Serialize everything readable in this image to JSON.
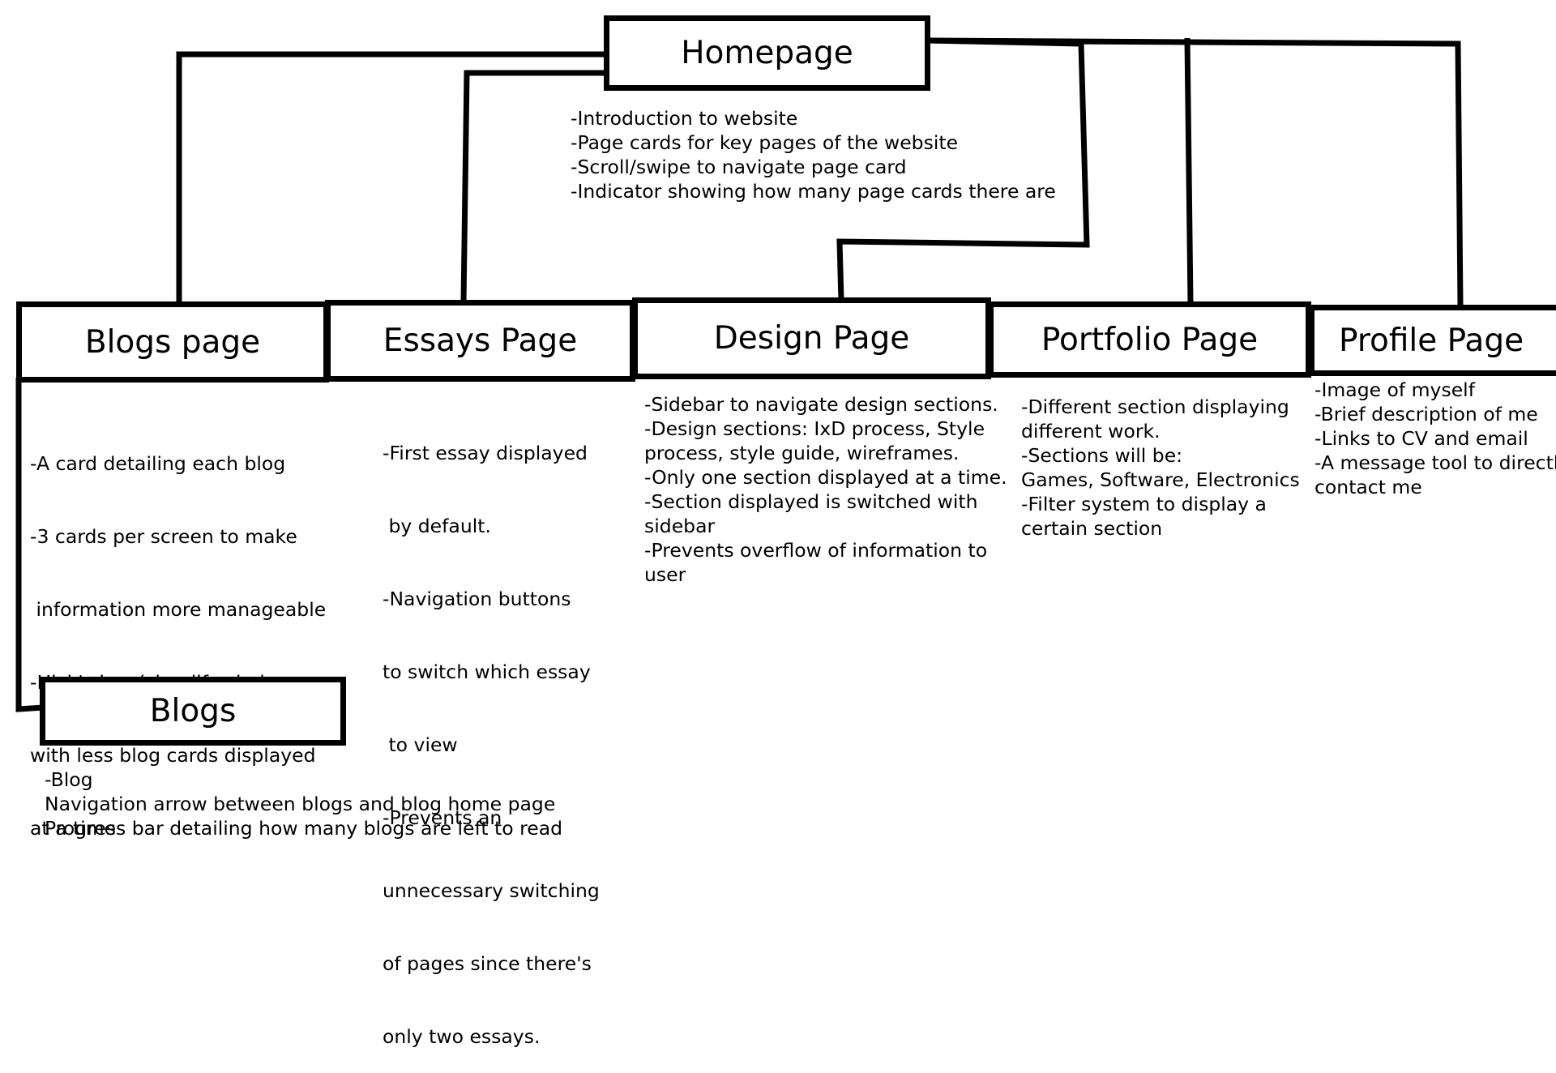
{
  "nodes": {
    "homepage": {
      "label": "Homepage",
      "notes": [
        "-Introduction to website",
        "-Page cards for key pages of the website",
        "-Scroll/swipe to navigate page card",
        "-Indicator showing how many page cards there are"
      ]
    },
    "blogs_page": {
      "label": "Blogs page",
      "notes": [
        "-A card detailing each blog",
        "-3 cards per screen to make",
        " information more manageable",
        "-Hick's law (simplify choices",
        "with less blog cards displayed",
        "at a time"
      ]
    },
    "essays_page": {
      "label": "Essays Page",
      "notes": [
        "-First essay displayed",
        " by default.",
        "-Navigation buttons",
        "to switch which essay",
        " to view",
        "-Prevents an",
        "unnecessary switching",
        "of pages since there's",
        "only two essays."
      ]
    },
    "design_page": {
      "label": "Design Page",
      "notes": [
        "-Sidebar to navigate design sections.",
        "-Design sections: IxD process, Style",
        "process, style guide, wireframes.",
        "-Only one section displayed at a time.",
        "-Section displayed is switched with",
        "sidebar",
        "-Prevents overflow of information to",
        "user"
      ]
    },
    "portfolio_page": {
      "label": "Portfolio Page",
      "notes": [
        "-Different section displaying",
        "different work.",
        "-Sections will be:",
        "Games, Software, Electronics",
        "-Filter system to display a",
        "certain section"
      ]
    },
    "profile_page": {
      "label": "Profile Page",
      "notes": [
        "-Image of myself",
        "-Brief description of me",
        "-Links to CV and email",
        "-A message tool to directly",
        "contact me"
      ]
    },
    "blogs": {
      "label": "Blogs",
      "notes": [
        "-Blog",
        "Navigation arrow between blogs and blog home page",
        "Progress bar detailing how many blogs are left to read"
      ]
    }
  }
}
